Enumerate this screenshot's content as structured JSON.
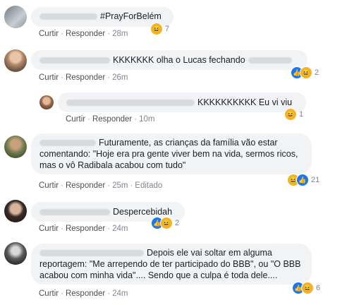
{
  "actions": {
    "like": "Curtir",
    "reply": "Responder",
    "edited": "Editado",
    "sep": "·"
  },
  "comments": [
    {
      "text": "#PrayForBelém",
      "time": "28m",
      "count": "7"
    },
    {
      "text": "KKKKKKK olha o Lucas fechando",
      "time": "26m",
      "count": "2"
    },
    {
      "text": "KKKKKKKKKK Eu vi viu",
      "time": "10m",
      "count": "1"
    },
    {
      "text": "Futuramente, as crianças da família vão estar comentando: \"Hoje era pra gente viver bem na vida, sermos ricos, mas o vô Radibala acabou com tudo\"",
      "time": "25m",
      "count": "21"
    },
    {
      "text": "Despercebidah",
      "time": "24m",
      "count": "2"
    },
    {
      "text": "Depois ele vai soltar em alguma reportagem: \"Me arrependo de ter participado do BBB\", ou \"O BBB acabou com minha vida\".... Sendo que a culpa é toda dele....",
      "time": "24m",
      "count": "6"
    }
  ]
}
